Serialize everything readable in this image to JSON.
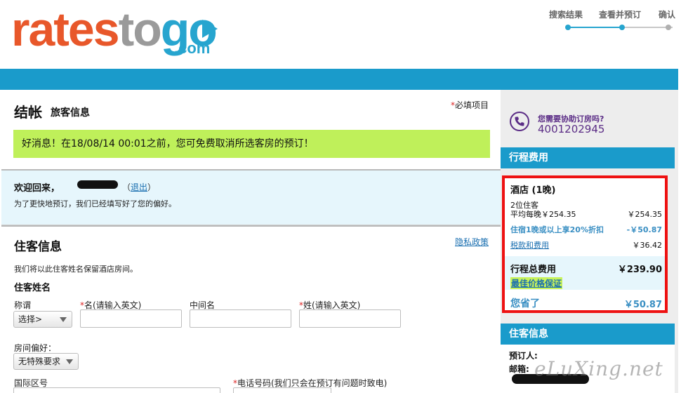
{
  "brand": {
    "logo_part1": "rates",
    "logo_part2": "to",
    "logo_part3": "go",
    "logo_dotcom": ".com"
  },
  "steps": [
    {
      "label": "搜索结果"
    },
    {
      "label": "查看并预订"
    },
    {
      "label": "确认"
    }
  ],
  "checkout": {
    "title": "结帐",
    "subtitle": "旅客信息",
    "required_star": "*",
    "required_note": "必填项目",
    "good_news": "好消息！在18/08/14 00:01之前，您可免费取消所选客房的预订！"
  },
  "welcome": {
    "greeting": "欢迎回来，",
    "logout_open": "（",
    "logout_label": "退出",
    "logout_close": "）",
    "prefill_note": "为了更快地预订，我们已经填写好了您的偏好。"
  },
  "guest_form": {
    "title": "住客信息",
    "privacy_link": "隐私政策",
    "hold_note": "我们将以此住客姓名保留酒店房间。",
    "name_section": "住客姓名",
    "salutation_label": "称谓",
    "salutation_value": "选择>",
    "first_name_label": "名(请输入英文)",
    "middle_name_label": "中间名",
    "last_name_label": "姓(请输入英文)",
    "room_pref_label": "房间偏好：",
    "room_pref_value": "无特殊要求",
    "country_code_label": "国际区号",
    "phone_label": "电话号码(我们只会在预订有问题时致电)",
    "star": "*"
  },
  "help": {
    "question": "您需要协助订房吗?",
    "phone": "4001202945"
  },
  "trip_cost": {
    "header": "行程费用",
    "hotel_label": "酒店 (1晚)",
    "guests": "2位住客",
    "avg_nightly_label": "平均每晚￥254.35",
    "avg_nightly_value": "￥254.35",
    "discount_label": "住宿1晚或以上享20%折扣",
    "discount_value": "-￥50.87",
    "taxes_label": "税款和费用",
    "taxes_value": "￥36.42",
    "total_label": "行程总费用",
    "total_value": "￥239.90",
    "best_price": "最佳价格保证",
    "saved_label": "您省了",
    "saved_value": "￥50.87"
  },
  "guest_panel": {
    "header": "住客信息",
    "booker_label": "预订人:",
    "email_label": "邮箱:",
    "watermark": "eLuXing.net"
  },
  "colors": {
    "brand_orange": "#e8572a",
    "brand_gray": "#9a9a9a",
    "brand_blue": "#27a5cf",
    "header_bar": "#1a9bcb",
    "good_news_bg": "#bff05a",
    "highlight_red": "#ee1111",
    "help_purple": "#5b2d86"
  }
}
